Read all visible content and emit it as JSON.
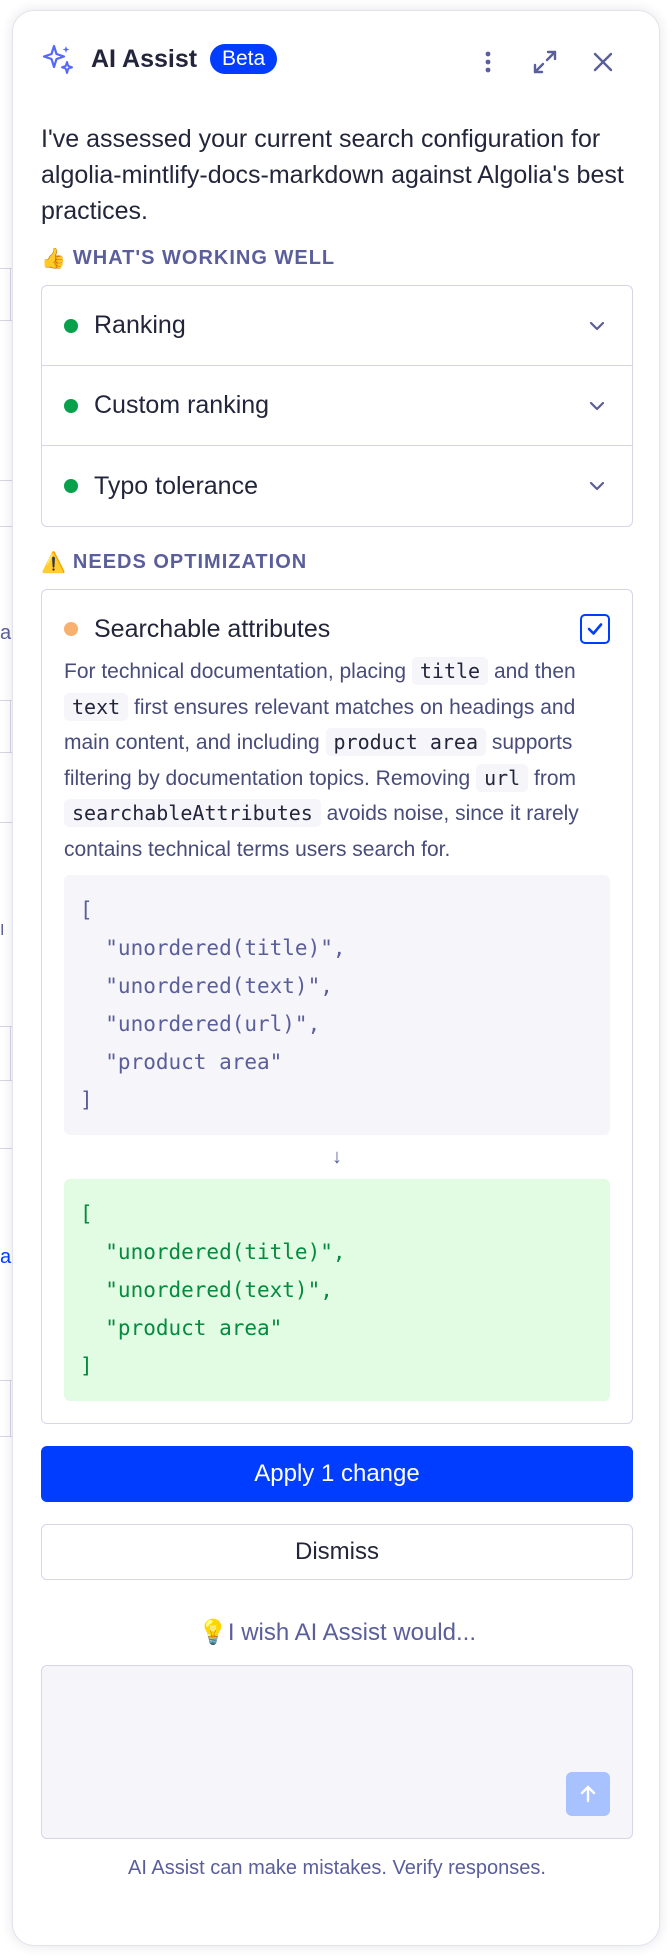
{
  "background": {
    "fragments": [
      "al",
      "I",
      "ar"
    ]
  },
  "header": {
    "title": "AI Assist",
    "badge": "Beta",
    "icons": [
      "sparkle-icon",
      "more-vertical-icon",
      "expand-icon",
      "close-icon"
    ]
  },
  "intro": "I've assessed your current search configuration for algolia-mintlify-docs-markdown against Algolia's best practices.",
  "working_well": {
    "emoji": "👍",
    "title": "WHAT'S WORKING WELL",
    "items": [
      {
        "label": "Ranking",
        "status_color": "#06a14a"
      },
      {
        "label": "Custom ranking",
        "status_color": "#06a14a"
      },
      {
        "label": "Typo tolerance",
        "status_color": "#06a14a"
      }
    ]
  },
  "needs_optimization": {
    "emoji": "⚠️",
    "title": "NEEDS OPTIMIZATION",
    "item": {
      "label": "Searchable attributes",
      "status_color": "#f8b06e",
      "checked": true,
      "desc": {
        "p1": "For technical documentation, placing",
        "c1": "title",
        "p2": "and then",
        "c2": "text",
        "p3": "first ensures relevant matches on headings and main content, and including",
        "c3": "product area",
        "p4": "supports filtering by documentation topics. Removing",
        "c4": "url",
        "p5": "from",
        "c5": "searchableAttributes",
        "p6": "avoids noise, since it rarely contains technical terms users search for."
      },
      "old_code": "[\n  \"unordered(title)\",\n  \"unordered(text)\",\n  \"unordered(url)\",\n  \"product area\"\n]",
      "arrow": "↓",
      "new_code": "[\n  \"unordered(title)\",\n  \"unordered(text)\",\n  \"product area\"\n]"
    }
  },
  "actions": {
    "apply": "Apply 1 change",
    "dismiss": "Dismiss"
  },
  "feedback": {
    "emoji": "💡",
    "prompt": "I wish AI Assist would...",
    "placeholder": ""
  },
  "disclaimer": "AI Assist can make mistakes. Verify responses.",
  "colors": {
    "accent": "#003dff",
    "success": "#06a14a",
    "warning": "#f8b06e",
    "muted": "#5a5e9a"
  }
}
